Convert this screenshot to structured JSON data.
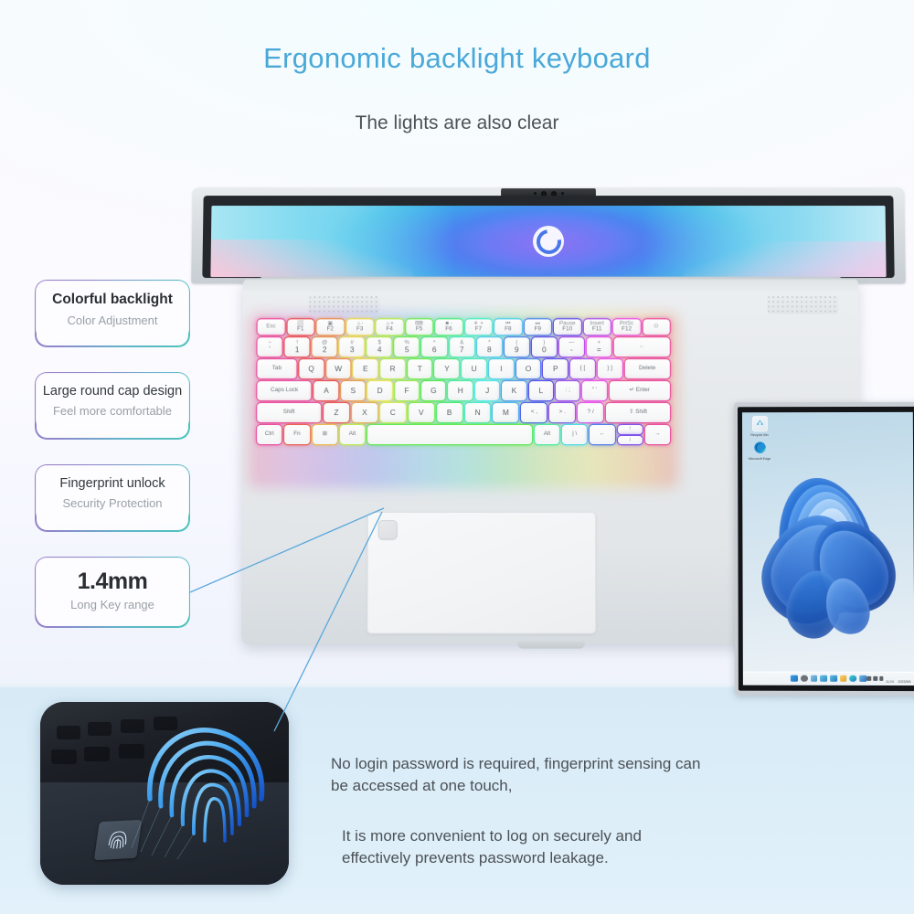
{
  "headings": {
    "title": "Ergonomic backlight keyboard",
    "subtitle": "The lights are also clear",
    "title_color": "#4aa8d8"
  },
  "callouts": [
    {
      "title": "Colorful backlight",
      "subtitle": "Color Adjustment"
    },
    {
      "title": "Large round cap design",
      "subtitle": "Feel more comfortable"
    },
    {
      "title": "Fingerprint unlock",
      "subtitle": "Security Protection"
    },
    {
      "title": "1.4mm",
      "subtitle": "Long Key range"
    }
  ],
  "bottom_text": {
    "paragraph1": "No login password is required, fingerprint sensing can be accessed at one touch,",
    "paragraph2": "It is more convenient to log on securely and effectively prevents password leakage."
  },
  "keyboard": {
    "function_row": [
      {
        "top": "Esc",
        "sub": ""
      },
      {
        "top": "⬜",
        "sub": "F1"
      },
      {
        "top": "▣",
        "sub": "F2"
      },
      {
        "top": "☼-",
        "sub": "F3"
      },
      {
        "top": "☼+",
        "sub": "F4"
      },
      {
        "top": "⌨",
        "sub": "F5"
      },
      {
        "top": "■ -",
        "sub": "F6"
      },
      {
        "top": "☀ +",
        "sub": "F7"
      },
      {
        "top": "⏮",
        "sub": "F8"
      },
      {
        "top": "⏭",
        "sub": "F9"
      },
      {
        "top": "Pause",
        "sub": "F10"
      },
      {
        "top": "Insert",
        "sub": "F11"
      },
      {
        "top": "PrtSc",
        "sub": "F12"
      },
      {
        "top": "⏻",
        "sub": ""
      }
    ],
    "number_row": [
      {
        "top": "~",
        "sub": "`"
      },
      {
        "top": "!",
        "sub": "1"
      },
      {
        "top": "@",
        "sub": "2"
      },
      {
        "top": "#",
        "sub": "3"
      },
      {
        "top": "$",
        "sub": "4"
      },
      {
        "top": "%",
        "sub": "5"
      },
      {
        "top": "^",
        "sub": "6"
      },
      {
        "top": "&",
        "sub": "7"
      },
      {
        "top": "*",
        "sub": "8"
      },
      {
        "top": "(",
        "sub": "9"
      },
      {
        "top": ")",
        "sub": "0"
      },
      {
        "top": "—",
        "sub": "-"
      },
      {
        "top": "+",
        "sub": "="
      },
      {
        "top": "←",
        "sub": ""
      }
    ],
    "q_row": [
      "Tab",
      "Q",
      "W",
      "E",
      "R",
      "T",
      "Y",
      "U",
      "I",
      "O",
      "P",
      "{ [",
      "} ]",
      "Delete"
    ],
    "a_row": [
      "Caps Lock",
      "A",
      "S",
      "D",
      "F",
      "G",
      "H",
      "J",
      "K",
      "L",
      ": ;",
      "\" '",
      "↵ Enter"
    ],
    "z_row": [
      "Shift",
      "Z",
      "X",
      "C",
      "V",
      "B",
      "N",
      "M",
      "< ,",
      "> .",
      "? /",
      "⇧ Shift"
    ],
    "space_row": [
      "Ctrl",
      "Fn",
      "⊞",
      "Alt",
      "",
      "Alt",
      "| \\",
      "←",
      "↑",
      "↓",
      "→"
    ]
  },
  "windows_screen": {
    "desktop_icons": [
      {
        "name": "Recycle Bin",
        "icon": "recycle-bin-icon"
      },
      {
        "name": "Microsoft Edge",
        "icon": "edge-icon"
      }
    ],
    "taskbar": {
      "icons": [
        "start-icon",
        "search-icon",
        "task-view-icon",
        "widgets-icon",
        "chat-icon",
        "explorer-icon",
        "edge-icon",
        "store-icon"
      ],
      "tray_time": "11:24",
      "tray_date": "2023/5/6"
    }
  },
  "fingerprint_inset": {
    "label": "fingerprint-sensor-photo"
  },
  "colors": {
    "accent_blue": "#4aa8d8",
    "leader_line": "#5ba8db",
    "callout_border_start": "#9b7fc4",
    "callout_border_end": "#4ec3b8",
    "bottom_bg": "#d7eaf6"
  }
}
